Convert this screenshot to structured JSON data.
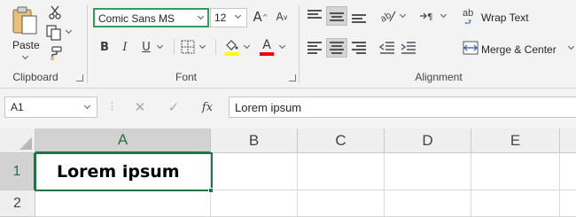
{
  "clipboard": {
    "paste_label": "Paste",
    "group_label": "Clipboard",
    "icons": [
      "paste-icon",
      "cut-icon",
      "copy-icon",
      "format-painter-icon"
    ]
  },
  "font": {
    "group_label": "Font",
    "font_name": "Comic Sans MS",
    "font_size": "12",
    "bold": "B",
    "italic": "I",
    "underline": "U",
    "increase_size": "A",
    "decrease_size": "A",
    "highlight_color": "#ffff00",
    "font_color": "#ff0000"
  },
  "alignment": {
    "group_label": "Alignment",
    "wrap_text_label": "Wrap Text",
    "wrap_text_icon": "ab",
    "merge_center_label": "Merge & Center",
    "active_vertical": "middle-align",
    "active_horizontal": "center-align"
  },
  "formula_bar": {
    "name_box": "A1",
    "fx_label": "fx",
    "content": "Lorem ipsum"
  },
  "sheet": {
    "columns": [
      "A",
      "B",
      "C",
      "D",
      "E"
    ],
    "rows": [
      "1",
      "2"
    ],
    "selected_cell": "A1",
    "cells": {
      "A1": "Lorem ipsum"
    }
  },
  "colors": {
    "accent_green": "#217346",
    "focus_green": "#2f9e57"
  }
}
